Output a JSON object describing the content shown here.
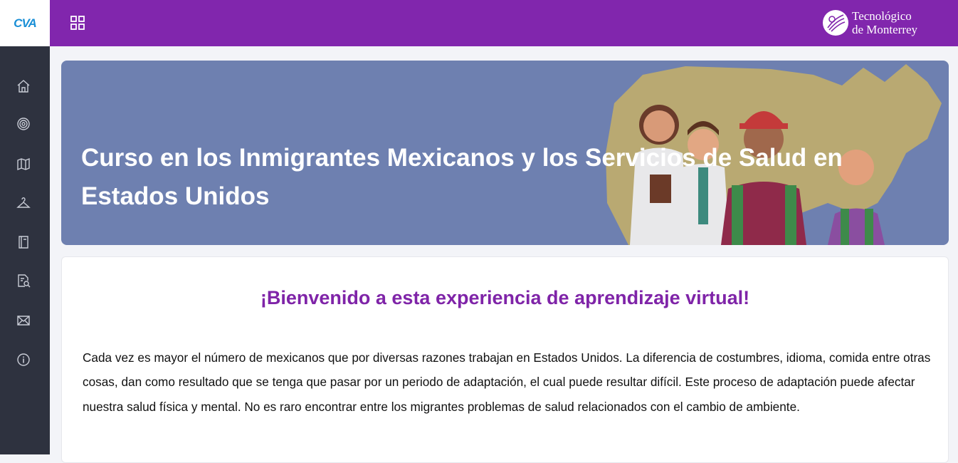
{
  "header": {
    "brand_logo": "CVA",
    "apps_icon": "grid-icon",
    "institution_line1": "Tecnológico",
    "institution_line2": "de Monterrey"
  },
  "sidebar": {
    "items": [
      {
        "icon": "home-icon"
      },
      {
        "icon": "target-icon"
      },
      {
        "icon": "map-icon"
      },
      {
        "icon": "hanger-icon"
      },
      {
        "icon": "book-icon"
      },
      {
        "icon": "document-search-icon"
      },
      {
        "icon": "mail-icon"
      },
      {
        "icon": "info-icon"
      }
    ]
  },
  "banner": {
    "title": "Curso en los Inmigrantes Mexicanos y los Servicios de Salud en Estados Unidos"
  },
  "content": {
    "welcome": "¡Bienvenido a esta experiencia de aprendizaje virtual!",
    "intro": "Cada vez es mayor el número de mexicanos que por diversas razones trabajan en Estados Unidos. La diferencia de costumbres, idioma, comida entre otras cosas, dan como resultado que se tenga que pasar por un periodo de adaptación, el cual puede resultar difícil. Este proceso de adaptación puede afectar nuestra salud física y mental. No es raro encontrar entre los migrantes problemas de salud relacionados con el cambio de ambiente."
  },
  "colors": {
    "topbar": "#8126ad",
    "sidebar": "#2e323f",
    "banner": "#6e80b0",
    "welcome_text": "#7f24a8"
  }
}
